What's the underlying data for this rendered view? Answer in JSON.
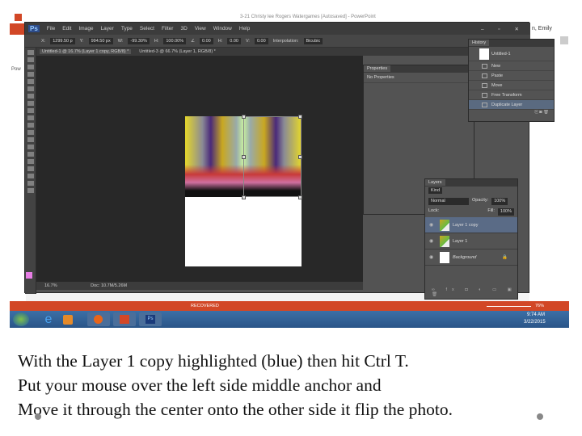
{
  "powerpoint": {
    "window_title": "3-21 Christy lee Rogers Watergames [Autosaved] - PowerPoint",
    "user": "n, Emily",
    "status": "RECOVERED",
    "zoom": "76%",
    "side_text": "Pow"
  },
  "photoshop": {
    "menu": [
      "File",
      "Edit",
      "Image",
      "Layer",
      "Type",
      "Select",
      "Filter",
      "3D",
      "View",
      "Window",
      "Help"
    ],
    "options": {
      "x": "1299.50 p",
      "y": "994.50 px",
      "w": "-99.30%",
      "h": "100.00%",
      "angle": "0.00",
      "h_skew": "0.00",
      "v_skew": "0.00",
      "interpolation_label": "Interpolation:",
      "interpolation": "Bicubic"
    },
    "tabs": [
      "Untitled-1 @ 16.7% (Layer 1 copy, RGB/8) *",
      "Untitled-3 @ 66.7% (Layer 1, RGB/8) *"
    ],
    "status": {
      "zoom": "16.7%",
      "doc": "Doc: 10.7M/5.26M"
    },
    "foreground_color": "#e87ee6"
  },
  "history": {
    "title": "History",
    "snapshot": "Untitled-1",
    "items": [
      "New",
      "Paste",
      "Move",
      "Free Transform",
      "Duplicate Layer"
    ],
    "selected": "Duplicate Layer"
  },
  "properties": {
    "title": "Properties",
    "subtitle": "No Properties"
  },
  "layers": {
    "title": "Layers",
    "filter": "Kind",
    "blend_mode": "Normal",
    "opacity_label": "Opacity:",
    "opacity": "100%",
    "lock_label": "Lock:",
    "fill_label": "Fill:",
    "fill": "100%",
    "items": [
      "Layer 1 copy",
      "Layer 1",
      "Background"
    ],
    "selected": "Layer 1 copy"
  },
  "taskbar": {
    "time": "9:74 AM",
    "date": "3/22/2015",
    "apps": [
      "start",
      "internet-explorer",
      "media-player",
      "firefox",
      "powerpoint",
      "photoshop"
    ]
  },
  "caption": [
    "With the Layer 1 copy highlighted (blue) then hit Ctrl T.",
    "Put your mouse over the left side middle anchor and",
    "Move it through the center onto the other side it flip the photo."
  ]
}
